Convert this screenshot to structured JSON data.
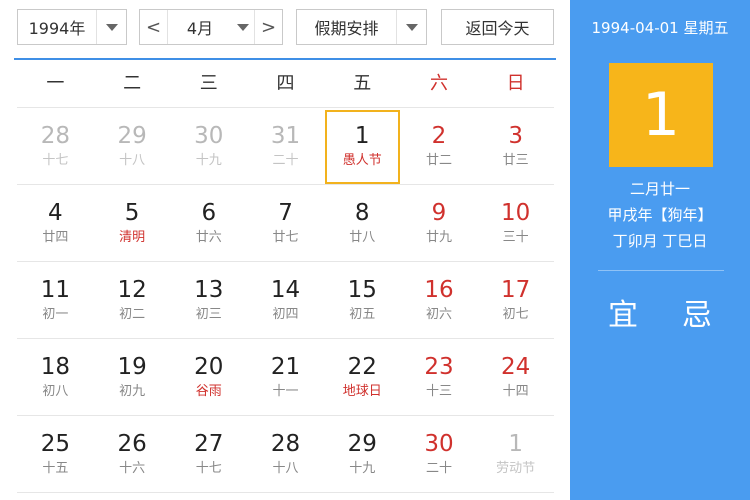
{
  "toolbar": {
    "year": "1994年",
    "month": "4月",
    "prev_arrow": "<",
    "next_arrow": ">",
    "holiday": "假期安排",
    "today": "返回今天"
  },
  "weekdays": [
    "一",
    "二",
    "三",
    "四",
    "五",
    "六",
    "日"
  ],
  "weeks": [
    [
      {
        "day": "28",
        "lunar": "十七",
        "other": true
      },
      {
        "day": "29",
        "lunar": "十八",
        "other": true
      },
      {
        "day": "30",
        "lunar": "十九",
        "other": true
      },
      {
        "day": "31",
        "lunar": "二十",
        "other": true
      },
      {
        "day": "1",
        "lunar": "愚人节",
        "festival": true,
        "selected": true
      },
      {
        "day": "2",
        "lunar": "廿二"
      },
      {
        "day": "3",
        "lunar": "廿三"
      }
    ],
    [
      {
        "day": "4",
        "lunar": "廿四"
      },
      {
        "day": "5",
        "lunar": "清明",
        "festival": true
      },
      {
        "day": "6",
        "lunar": "廿六"
      },
      {
        "day": "7",
        "lunar": "廿七"
      },
      {
        "day": "8",
        "lunar": "廿八"
      },
      {
        "day": "9",
        "lunar": "廿九"
      },
      {
        "day": "10",
        "lunar": "三十"
      }
    ],
    [
      {
        "day": "11",
        "lunar": "初一"
      },
      {
        "day": "12",
        "lunar": "初二"
      },
      {
        "day": "13",
        "lunar": "初三"
      },
      {
        "day": "14",
        "lunar": "初四"
      },
      {
        "day": "15",
        "lunar": "初五"
      },
      {
        "day": "16",
        "lunar": "初六"
      },
      {
        "day": "17",
        "lunar": "初七"
      }
    ],
    [
      {
        "day": "18",
        "lunar": "初八"
      },
      {
        "day": "19",
        "lunar": "初九"
      },
      {
        "day": "20",
        "lunar": "谷雨",
        "festival": true
      },
      {
        "day": "21",
        "lunar": "十一"
      },
      {
        "day": "22",
        "lunar": "地球日",
        "festival": true
      },
      {
        "day": "23",
        "lunar": "十三"
      },
      {
        "day": "24",
        "lunar": "十四"
      }
    ],
    [
      {
        "day": "25",
        "lunar": "十五"
      },
      {
        "day": "26",
        "lunar": "十六"
      },
      {
        "day": "27",
        "lunar": "十七"
      },
      {
        "day": "28",
        "lunar": "十八"
      },
      {
        "day": "29",
        "lunar": "十九"
      },
      {
        "day": "30",
        "lunar": "二十"
      },
      {
        "day": "1",
        "lunar": "劳动节",
        "other": true
      }
    ]
  ],
  "panel": {
    "date_line": "1994-04-01 星期五",
    "day": "1",
    "lunar_date": "二月廿一",
    "year_ganzhi": "甲戌年【狗年】",
    "month_day_ganzhi": "丁卯月 丁巳日",
    "yi": "宜",
    "ji": "忌"
  },
  "colors": {
    "accent_blue": "#4a9cf0",
    "highlight_gold": "#f7b51a",
    "holiday_red": "#d0312d"
  }
}
